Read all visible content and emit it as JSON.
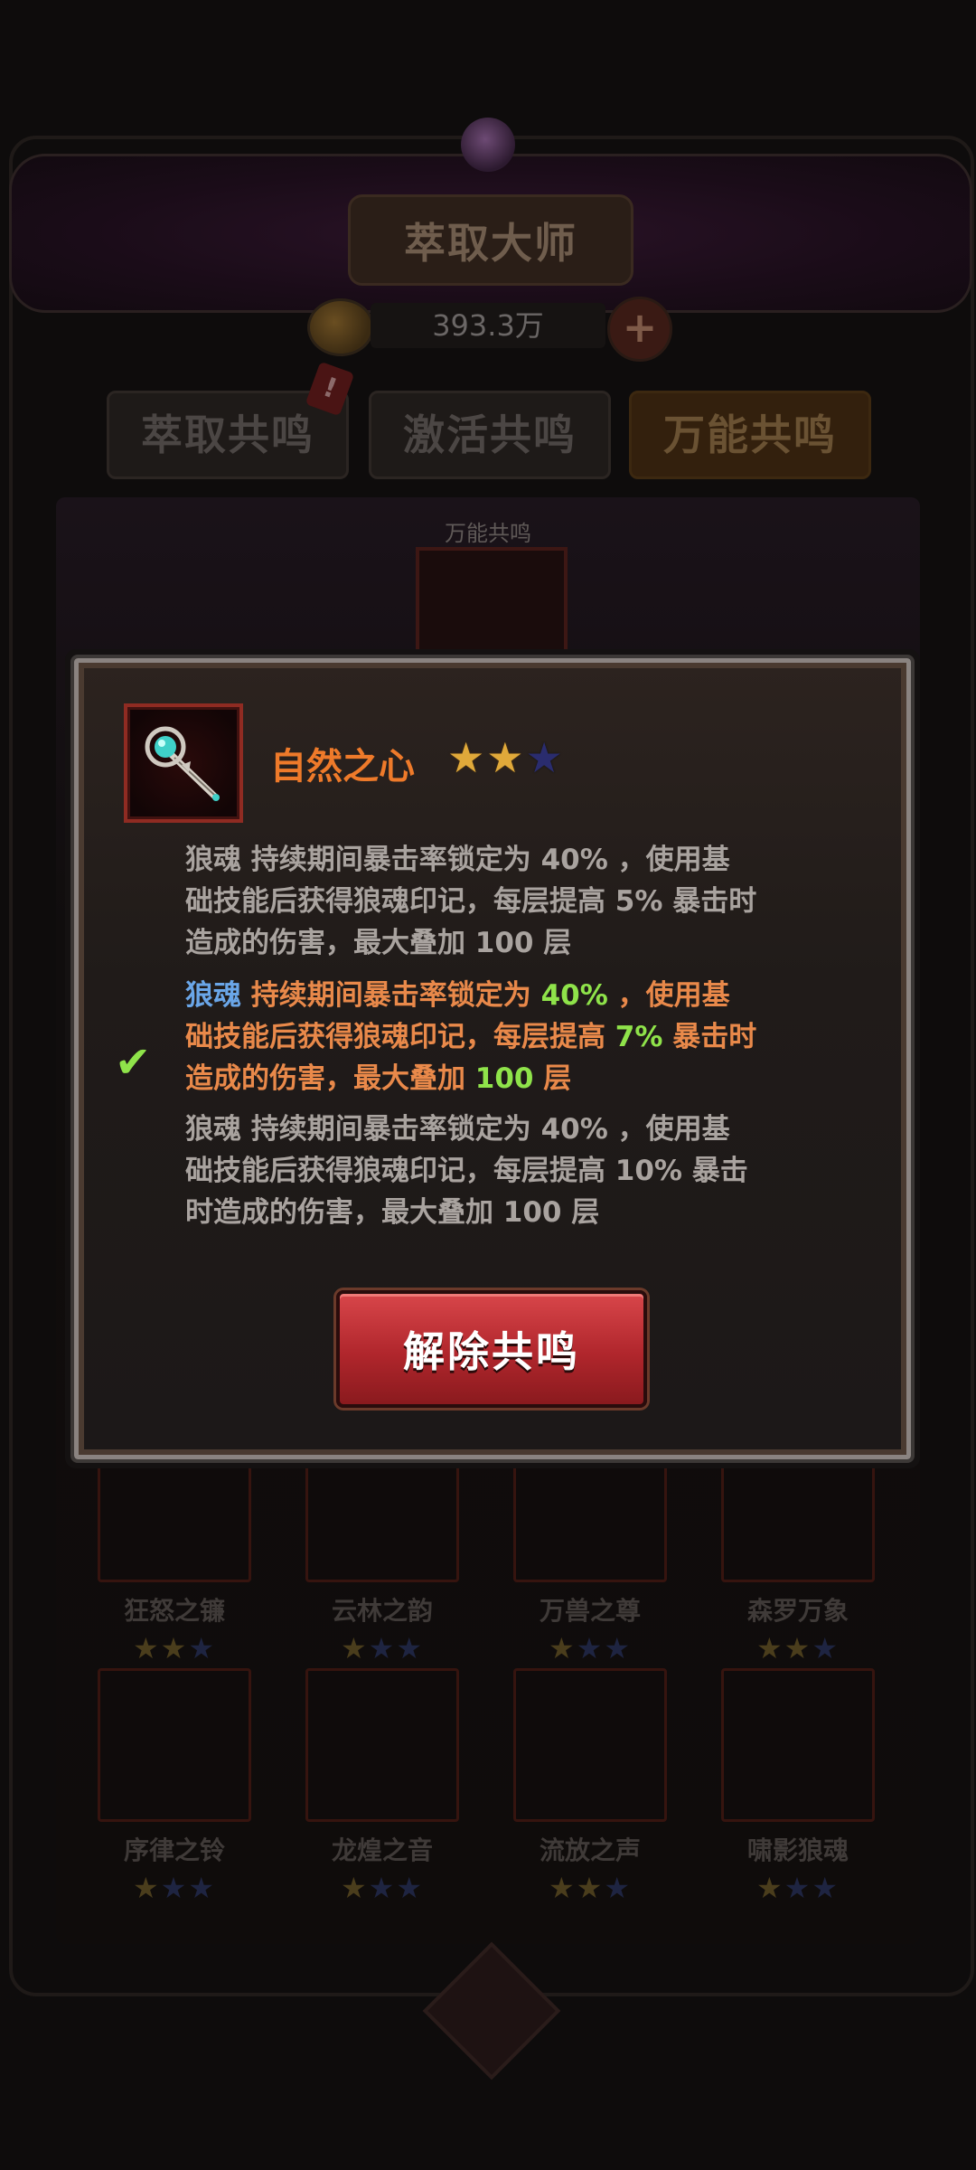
{
  "header": {
    "title": "萃取大师",
    "currency_value": "393.3万",
    "plus_label": "+"
  },
  "tabs": [
    {
      "label": "萃取共鸣",
      "active": false
    },
    {
      "label": "激活共鸣",
      "active": false
    },
    {
      "label": "万能共鸣",
      "active": true
    }
  ],
  "tab_badge": "!",
  "section_label": "万能共鸣",
  "grid": [
    {
      "name": "狂怒之镰",
      "stars_lit": 2,
      "stars_total": 3
    },
    {
      "name": "云林之韵",
      "stars_lit": 1,
      "stars_total": 3
    },
    {
      "name": "万兽之尊",
      "stars_lit": 1,
      "stars_total": 3
    },
    {
      "name": "森罗万象",
      "stars_lit": 2,
      "stars_total": 3
    },
    {
      "name": "序律之铃",
      "stars_lit": 1,
      "stars_total": 3
    },
    {
      "name": "龙煌之音",
      "stars_lit": 1,
      "stars_total": 3
    },
    {
      "name": "流放之声",
      "stars_lit": 2,
      "stars_total": 3
    },
    {
      "name": "啸影狼魂",
      "stars_lit": 1,
      "stars_total": 3
    }
  ],
  "modal": {
    "item_name": "自然之心",
    "stars_lit": 2,
    "stars_total": 3,
    "effects": [
      {
        "keyword": "狼魂",
        "line1a": " 持续期间暴击率锁定为 ",
        "v1": "40%",
        "line1b": " ，使用基",
        "line2a": "础技能后获得狼魂印记，每层提高 ",
        "v2": "5%",
        "line2b": " 暴击时",
        "line3a": "造成的伤害，最大叠加 ",
        "v3": "100",
        "line3b": " 层",
        "active": false
      },
      {
        "keyword": "狼魂",
        "line1a": " 持续期间暴击率锁定为 ",
        "v1": "40%",
        "line1b": " ，使用基",
        "line2a": "础技能后获得狼魂印记，每层提高 ",
        "v2": "7%",
        "line2b": " 暴击时",
        "line3a": "造成的伤害，最大叠加 ",
        "v3": "100",
        "line3b": " 层",
        "active": true
      },
      {
        "keyword": "狼魂",
        "line1a": " 持续期间暴击率锁定为 ",
        "v1": "40%",
        "line1b": " ，使用基",
        "line2a": "础技能后获得狼魂印记，每层提高 ",
        "v2": "10%",
        "line2b": " 暴击",
        "line3a": "时造成的伤害，最大叠加 ",
        "v3": "100",
        "line3b": " 层",
        "active": false
      }
    ],
    "selected_check": "✔",
    "button_label": "解除共鸣"
  },
  "colors": {
    "item_name": "#ee7a2a",
    "keyword_active": "#6aa6e8",
    "number_active": "#8fe34a",
    "button_red": "#c0282d"
  },
  "icons": {
    "item": "magic-staff-icon",
    "currency": "coin-icon",
    "check": "check-icon"
  }
}
